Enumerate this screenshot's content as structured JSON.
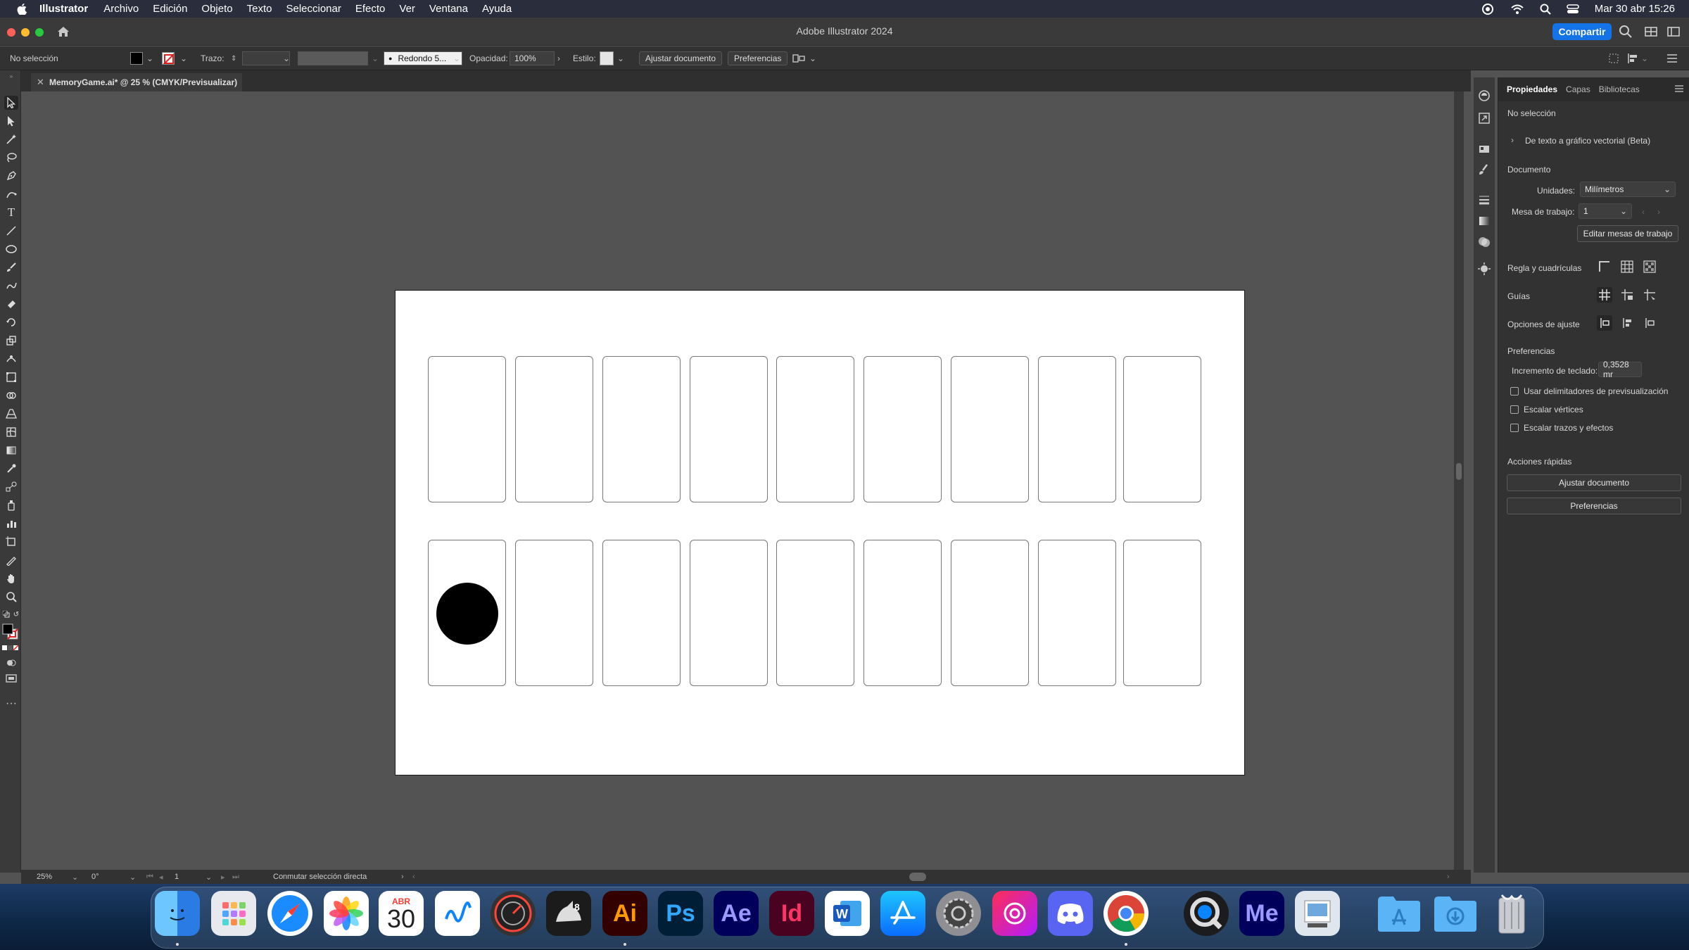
{
  "menubar": {
    "app_name": "Illustrator",
    "items": [
      "Archivo",
      "Edición",
      "Objeto",
      "Texto",
      "Seleccionar",
      "Efecto",
      "Ver",
      "Ventana",
      "Ayuda"
    ],
    "clock": "Mar 30 abr  15:26"
  },
  "window": {
    "title": "Adobe Illustrator 2024",
    "share_label": "Compartir"
  },
  "controlbar": {
    "selection": "No selección",
    "stroke_label": "Trazo:",
    "brush_label": "Redondo 5...",
    "opacity_label": "Opacidad:",
    "opacity_value": "100%",
    "style_label": "Estilo:",
    "fit_doc_btn": "Ajustar documento",
    "prefs_btn": "Preferencias"
  },
  "document_tab": {
    "title": "MemoryGame.ai* @ 25 % (CMYK/Previsualizar)"
  },
  "statusbar": {
    "zoom": "25%",
    "rotation": "0°",
    "artboard": "1",
    "tool_hint": "Conmutar selección directa"
  },
  "panel": {
    "tabs": [
      "Propiedades",
      "Capas",
      "Bibliotecas"
    ],
    "selection": "No selección",
    "text_to_vector": "De texto a gráfico vectorial (Beta)",
    "document_heading": "Documento",
    "units_label": "Unidades:",
    "units_value": "Milímetros",
    "artboard_label": "Mesa de trabajo:",
    "artboard_value": "1",
    "edit_artboards_btn": "Editar mesas de trabajo",
    "rulers_heading": "Regla y cuadrículas",
    "guides_heading": "Guías",
    "snap_heading": "Opciones de ajuste",
    "prefs_heading": "Preferencias",
    "keyboard_inc_label": "Incremento de teclado:",
    "keyboard_inc_value": "0,3528 mr",
    "checkboxes": [
      "Usar delimitadores de previsualización",
      "Escalar vértices",
      "Escalar trazos y efectos"
    ],
    "quick_actions_heading": "Acciones rápidas",
    "quick_fit_btn": "Ajustar documento",
    "quick_prefs_btn": "Preferencias"
  },
  "dock": {
    "calendar_month": "ABR",
    "calendar_day": "30",
    "apps": [
      "Finder",
      "Launchpad",
      "Safari",
      "Fotos",
      "Calendario",
      "Freeform",
      "Compressor",
      "Rhino 8",
      "Illustrator",
      "Photoshop",
      "After Effects",
      "InDesign",
      "Word",
      "App Store",
      "Ajustes del Sistema",
      "Creative Cloud",
      "Discord",
      "Chrome",
      "QuickTime",
      "Media Encoder",
      "Vista Previa",
      "Aplicaciones",
      "Descargas",
      "Papelera"
    ]
  },
  "artboard": {
    "rows": 2,
    "cards_per_row": 9,
    "card_shape": "rounded rectangle outline",
    "filled_circle_in": "row 2, card 1"
  },
  "colors": {
    "accent": "#1473e6",
    "canvas_bg": "#535353",
    "panel_bg": "#323232",
    "artboard_bg": "#ffffff",
    "circle_fill": "#000000"
  }
}
